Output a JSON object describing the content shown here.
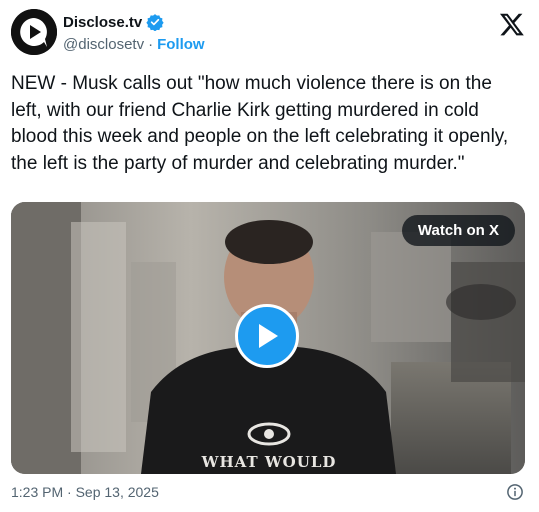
{
  "account": {
    "name": "Disclose.tv",
    "handle": "@disclosetv",
    "separator": "·",
    "follow_label": "Follow"
  },
  "tweet": {
    "text": "NEW - Musk calls out \"how much violence there is on the left, with our friend Charlie Kirk getting murdered in cold blood this week and people on the left celebrating it openly, the left is the party of murder and celebrating murder.\"",
    "timestamp": "1:23 PM · Sep 13, 2025"
  },
  "media": {
    "watch_label": "Watch on X",
    "shirt_text": "WHAT WOULD"
  },
  "icons": {
    "avatar": "disclose-tv-logo",
    "verified": "verified-badge-icon",
    "platform": "x-logo-icon",
    "play": "play-icon",
    "info": "info-icon"
  },
  "colors": {
    "accent": "#1d9bf0",
    "text": "#0f1419",
    "muted": "#536471"
  }
}
